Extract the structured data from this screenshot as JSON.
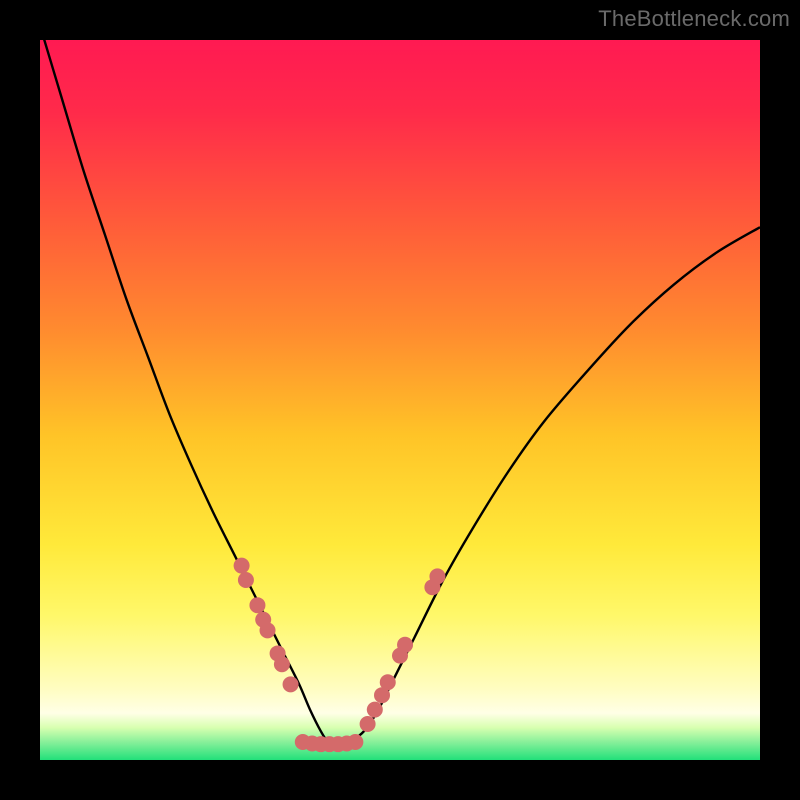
{
  "watermark": "TheBottleneck.com",
  "chart_data": {
    "type": "line",
    "title": "",
    "xlabel": "",
    "ylabel": "",
    "xlim": [
      0,
      100
    ],
    "ylim": [
      0,
      100
    ],
    "grid": false,
    "gradient_stops": [
      {
        "offset": 0.0,
        "color": "#ff1a52"
      },
      {
        "offset": 0.1,
        "color": "#ff2a4a"
      },
      {
        "offset": 0.25,
        "color": "#ff5a3a"
      },
      {
        "offset": 0.4,
        "color": "#ff8a2f"
      },
      {
        "offset": 0.55,
        "color": "#ffc427"
      },
      {
        "offset": 0.7,
        "color": "#ffe93a"
      },
      {
        "offset": 0.8,
        "color": "#fff86a"
      },
      {
        "offset": 0.9,
        "color": "#fffdc0"
      },
      {
        "offset": 0.935,
        "color": "#ffffe6"
      },
      {
        "offset": 0.955,
        "color": "#d8ffb0"
      },
      {
        "offset": 0.975,
        "color": "#88f09a"
      },
      {
        "offset": 1.0,
        "color": "#22e07a"
      }
    ],
    "series": [
      {
        "name": "bottleneck-curve",
        "color": "#000000",
        "width": 2.4,
        "x": [
          0.0,
          3.0,
          6.0,
          9.0,
          12.0,
          15.0,
          18.0,
          21.0,
          24.0,
          27.0,
          30.0,
          32.0,
          34.0,
          36.0,
          37.5,
          39.0,
          40.0,
          41.0,
          42.0,
          43.0,
          45.0,
          47.0,
          49.0,
          52.0,
          56.0,
          60.0,
          65.0,
          70.0,
          76.0,
          82.0,
          88.0,
          94.0,
          100.0
        ],
        "y": [
          102.0,
          92.0,
          82.0,
          73.0,
          64.0,
          56.0,
          48.0,
          41.0,
          34.5,
          28.5,
          22.5,
          18.5,
          14.5,
          10.5,
          7.0,
          4.0,
          2.5,
          2.2,
          2.2,
          2.5,
          4.0,
          7.0,
          11.0,
          17.0,
          25.0,
          32.0,
          40.0,
          47.0,
          54.0,
          60.5,
          66.0,
          70.5,
          74.0
        ]
      }
    ],
    "points": {
      "color": "#d46a6a",
      "radius": 8,
      "xy": [
        [
          28.0,
          27.0
        ],
        [
          28.6,
          25.0
        ],
        [
          30.2,
          21.5
        ],
        [
          31.0,
          19.5
        ],
        [
          31.6,
          18.0
        ],
        [
          33.0,
          14.8
        ],
        [
          33.6,
          13.3
        ],
        [
          34.8,
          10.5
        ],
        [
          36.5,
          2.5
        ],
        [
          37.8,
          2.3
        ],
        [
          39.0,
          2.2
        ],
        [
          40.2,
          2.2
        ],
        [
          41.4,
          2.2
        ],
        [
          42.6,
          2.3
        ],
        [
          43.8,
          2.5
        ],
        [
          45.5,
          5.0
        ],
        [
          46.5,
          7.0
        ],
        [
          47.5,
          9.0
        ],
        [
          48.3,
          10.8
        ],
        [
          50.0,
          14.5
        ],
        [
          50.7,
          16.0
        ],
        [
          54.5,
          24.0
        ],
        [
          55.2,
          25.5
        ]
      ]
    }
  }
}
